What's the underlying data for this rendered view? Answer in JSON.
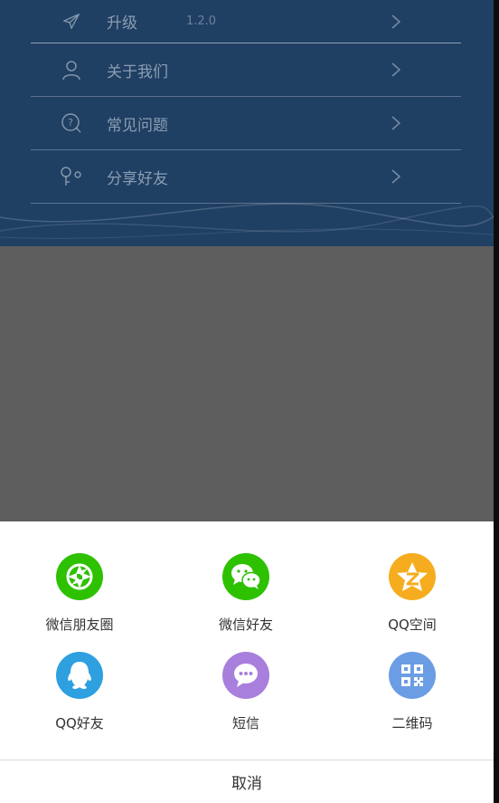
{
  "menu": {
    "items": [
      {
        "label": "升级",
        "version": "1.2.0",
        "icon": "paper-plane-icon"
      },
      {
        "label": "关于我们",
        "icon": "user-icon"
      },
      {
        "label": "常见问题",
        "icon": "question-icon"
      },
      {
        "label": "分享好友",
        "icon": "share-icon"
      }
    ]
  },
  "share_sheet": {
    "items": [
      {
        "label": "微信朋友圈",
        "icon": "wechat-moments-icon",
        "color": "#2dc100"
      },
      {
        "label": "微信好友",
        "icon": "wechat-icon",
        "color": "#2dc100"
      },
      {
        "label": "QQ空间",
        "icon": "qzone-icon",
        "color": "#f5ad1f"
      },
      {
        "label": "QQ好友",
        "icon": "qq-icon",
        "color": "#2ea0e0"
      },
      {
        "label": "短信",
        "icon": "sms-icon",
        "color": "#a87fdc"
      },
      {
        "label": "二维码",
        "icon": "qrcode-icon",
        "color": "#6b9de4"
      }
    ],
    "cancel_label": "取消"
  }
}
